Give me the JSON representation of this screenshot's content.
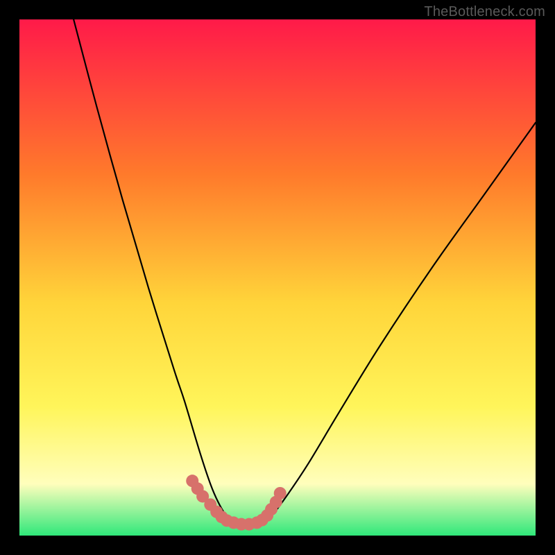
{
  "watermark": "TheBottleneck.com",
  "colors": {
    "background": "#000000",
    "gradient_top": "#ff1a49",
    "gradient_mid1": "#ff7a2b",
    "gradient_mid2": "#ffd53a",
    "gradient_mid3": "#fff55a",
    "gradient_band": "#fffebc",
    "gradient_bottom": "#2fe87a",
    "curve": "#000000",
    "highlight": "#d7716b"
  },
  "chart_data": {
    "type": "line",
    "title": "",
    "xlabel": "",
    "ylabel": "",
    "xlim": [
      0,
      100
    ],
    "ylim": [
      0,
      100
    ],
    "grid": false,
    "series": [
      {
        "name": "bottleneck-curve",
        "x": [
          10.5,
          15,
          20,
          25,
          30,
          32,
          35,
          37,
          38.5,
          40,
          42,
          44,
          46,
          47,
          49,
          52,
          56,
          62,
          70,
          80,
          90,
          100
        ],
        "y": [
          100,
          83,
          65,
          48,
          32,
          26,
          16,
          10,
          6.5,
          4,
          2.5,
          2,
          2,
          2.3,
          4,
          8,
          14,
          24,
          37,
          52,
          66,
          80
        ]
      }
    ],
    "highlight_region": {
      "name": "valley-highlight",
      "points_x": [
        33.5,
        34.5,
        35.5,
        37,
        38.2,
        39.2,
        40.2,
        41.5,
        43,
        44.5,
        46,
        47,
        48,
        48.8,
        49.7,
        50.5
      ],
      "points_y": [
        10.6,
        9.1,
        7.6,
        6.0,
        4.6,
        3.6,
        2.9,
        2.5,
        2.2,
        2.2,
        2.5,
        3.0,
        3.9,
        5.1,
        6.5,
        8.2
      ]
    },
    "annotations": []
  }
}
